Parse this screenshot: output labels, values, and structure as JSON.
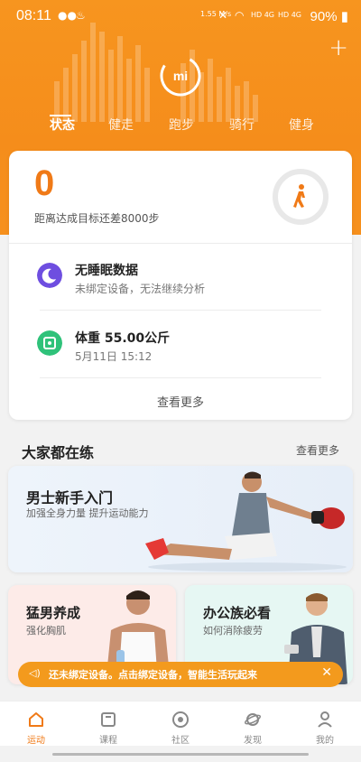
{
  "status_bar": {
    "time": "08:11",
    "speed": "1.55 M/s",
    "net1": "HD 4G",
    "net2": "HD 4G",
    "battery": "90%"
  },
  "header": {
    "tabs": [
      {
        "label": "状态",
        "active": true
      },
      {
        "label": "健走"
      },
      {
        "label": "跑步"
      },
      {
        "label": "骑行"
      },
      {
        "label": "健身"
      }
    ],
    "logo_text": "mi"
  },
  "steps": {
    "value": "0",
    "remaining": "距离达成目标还差8000步"
  },
  "rows": [
    {
      "title": "无睡眠数据",
      "sub": "未绑定设备，无法继续分析"
    },
    {
      "title": "体重  55.00公斤",
      "sub": "5月11日  15:12"
    }
  ],
  "main_see_more": "查看更多",
  "section": {
    "title": "大家都在练",
    "more": "查看更多"
  },
  "promos": [
    {
      "title": "男士新手入门",
      "sub": "加强全身力量 提升运动能力"
    },
    {
      "title": "猛男养成",
      "sub": "强化胸肌"
    },
    {
      "title": "办公族必看",
      "sub": "如何消除疲劳"
    }
  ],
  "toast": {
    "text": "还未绑定设备。点击绑定设备，智能生活玩起来"
  },
  "nav": [
    {
      "label": "运动",
      "active": true
    },
    {
      "label": "课程"
    },
    {
      "label": "社区"
    },
    {
      "label": "发现"
    },
    {
      "label": "我的"
    }
  ],
  "colors": {
    "accent": "#f07a17",
    "header": "#f7951f",
    "sleep": "#6e4ee0",
    "weight": "#2fc27a"
  }
}
